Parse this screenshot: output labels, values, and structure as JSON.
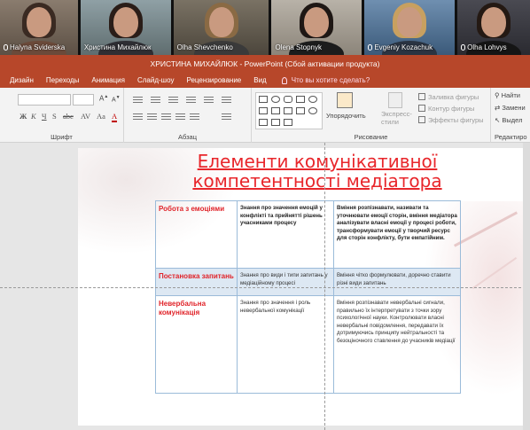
{
  "participants": [
    {
      "name": "Halyna Sviderska",
      "muted": true
    },
    {
      "name": "Христина Михайлюк",
      "muted": false
    },
    {
      "name": "Olha Shevchenko",
      "muted": false
    },
    {
      "name": "Olena Stopnyk",
      "muted": false
    },
    {
      "name": "Evgeniy Kozachuk",
      "muted": true
    },
    {
      "name": "Olha Lohvys",
      "muted": true
    }
  ],
  "window": {
    "title": "ХРИСТИНА МИХАЙЛЮК - PowerPoint (Сбой активации продукта)",
    "accent": "#b7472a"
  },
  "tabs": [
    {
      "label": "Дизайн"
    },
    {
      "label": "Переходы"
    },
    {
      "label": "Анимация"
    },
    {
      "label": "Слайд-шоу"
    },
    {
      "label": "Рецензирование"
    },
    {
      "label": "Вид"
    }
  ],
  "tell_me": "Что вы хотите сделать?",
  "ribbon": {
    "font_group_label": "Шрифт",
    "paragraph_group_label": "Абзац",
    "drawing_group_label": "Рисование",
    "editing_group_label": "Редактиро",
    "arrange_label": "Упорядочить",
    "quick_styles_label": "Экспресс-\nстили",
    "shape_fill_label": "Заливка фигуры",
    "shape_outline_label": "Контур фигуры",
    "shape_effects_label": "Эффекты фигуры",
    "find_label": "Найти",
    "replace_label": "Замени",
    "select_label": "Выдел"
  },
  "slide": {
    "title": "Елементи комунікативної компетентності медіатора",
    "title_color": "#e8262b",
    "table": [
      {
        "label": "Робота з емоціями",
        "knowledge": "Знання про значення емоцій у конфлікті та прийнятті рішень учасниками процесу",
        "skills": "Вміння розпізнавати, називати та уточнювати емоції сторін, вміння медіатора аналізувати власні емоції у процесі роботи, трансформувати емоції у творчий ресурс для сторін конфлікту, бути емпатійним."
      },
      {
        "label": "Постановка запитань",
        "knowledge": "Знання про види і типи запитань у медіаційному процесі",
        "skills": "Вміння чітко формулювати, доречно ставити різні види запитань"
      },
      {
        "label": "Невербальна комунікація",
        "knowledge": "Знання про значення і роль невербальної комунікації",
        "skills": "Вміння розпізнавати невербальні сигнали, правильно їх інтерпретувати з точки зору психологічної науки. Контролювати власні невербальні повідомлення, передавати їх дотримуючись принципу нейтральності та безоціночного ставлення до учасників медіації"
      }
    ]
  }
}
